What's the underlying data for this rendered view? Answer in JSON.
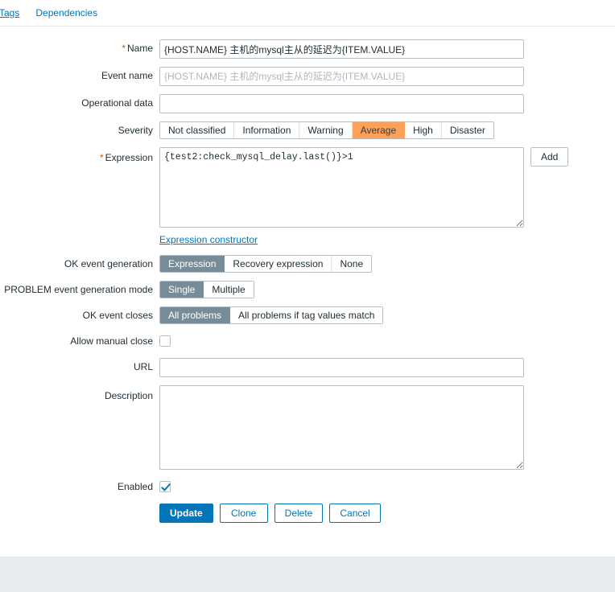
{
  "tabs": [
    {
      "label": "Tags",
      "active": false
    },
    {
      "label": "Dependencies",
      "active": false
    }
  ],
  "form": {
    "name": {
      "label": "Name",
      "required": true,
      "value": "{HOST.NAME} 主机的mysql主从的延迟为{ITEM.VALUE}"
    },
    "event_name": {
      "label": "Event name",
      "required": false,
      "value": "",
      "placeholder": "{HOST.NAME} 主机的mysql主从的延迟为{ITEM.VALUE}"
    },
    "operational_data": {
      "label": "Operational data",
      "required": false,
      "value": "",
      "placeholder": ""
    },
    "severity": {
      "label": "Severity",
      "options": [
        "Not classified",
        "Information",
        "Warning",
        "Average",
        "High",
        "Disaster"
      ],
      "selected": "Average",
      "selected_color": "#ffa059"
    },
    "expression": {
      "label": "Expression",
      "required": true,
      "value": "{test2:check_mysql_delay.last()}>1",
      "add_button": "Add",
      "constructor_link": "Expression constructor"
    },
    "ok_event_generation": {
      "label": "OK event generation",
      "options": [
        "Expression",
        "Recovery expression",
        "None"
      ],
      "selected": "Expression"
    },
    "problem_event_generation_mode": {
      "label": "PROBLEM event generation mode",
      "options": [
        "Single",
        "Multiple"
      ],
      "selected": "Single"
    },
    "ok_event_closes": {
      "label": "OK event closes",
      "options": [
        "All problems",
        "All problems if tag values match"
      ],
      "selected": "All problems"
    },
    "allow_manual_close": {
      "label": "Allow manual close",
      "checked": false
    },
    "url": {
      "label": "URL",
      "value": "",
      "placeholder": ""
    },
    "description": {
      "label": "Description",
      "value": "",
      "placeholder": ""
    },
    "enabled": {
      "label": "Enabled",
      "checked": true
    }
  },
  "actions": {
    "update": "Update",
    "clone": "Clone",
    "delete": "Delete",
    "cancel": "Cancel"
  },
  "colors": {
    "accent": "#0275b8",
    "selected_toggle": "#768d99",
    "severity_average": "#ffa059",
    "required_asterisk": "#d35400"
  }
}
